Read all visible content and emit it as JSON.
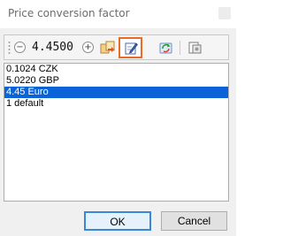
{
  "window": {
    "title": "Price conversion factor"
  },
  "toolbar": {
    "value": "4.4500",
    "icons": [
      "grip-icon",
      "minus-icon",
      "plus-icon",
      "copy-icon",
      "edit-icon",
      "refresh-icon",
      "document-icon"
    ],
    "highlight_color": "#e76c25"
  },
  "list": {
    "items": [
      "0.1024 CZK",
      "5.0220 GBP",
      "4.45 Euro",
      "1 default"
    ],
    "selected_index": 2,
    "selection_color": "#0a64d8"
  },
  "buttons": {
    "ok": "OK",
    "cancel": "Cancel"
  }
}
